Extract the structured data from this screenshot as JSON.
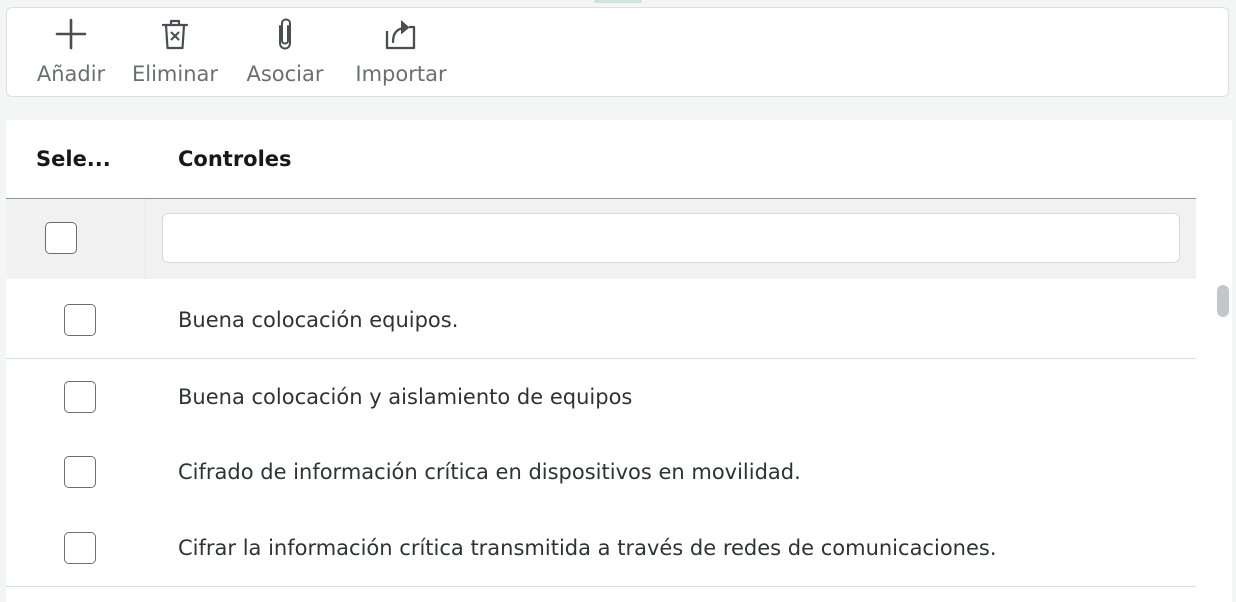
{
  "toolbar": {
    "add_label": "Añadir",
    "delete_label": "Eliminar",
    "associate_label": "Asociar",
    "import_label": "Importar"
  },
  "table": {
    "columns": {
      "select": "Sele...",
      "controls": "Controles"
    },
    "filter": {
      "value": "",
      "placeholder": ""
    },
    "rows": [
      {
        "control": "Buena colocación equipos."
      },
      {
        "control": "Buena colocación y aislamiento de equipos"
      },
      {
        "control": "Cifrado de información crítica en dispositivos en movilidad."
      },
      {
        "control": "Cifrar la información crítica transmitida a través de redes de comunicaciones."
      }
    ]
  },
  "icons": {
    "add": "plus-icon",
    "delete": "trash-icon",
    "associate": "paperclip-icon",
    "import": "import-icon"
  },
  "colors": {
    "toolbar_label": "#6b6e73",
    "header_text": "#16181b",
    "row_text": "#2f3236",
    "filter_row_bg": "#f1f1f1"
  }
}
